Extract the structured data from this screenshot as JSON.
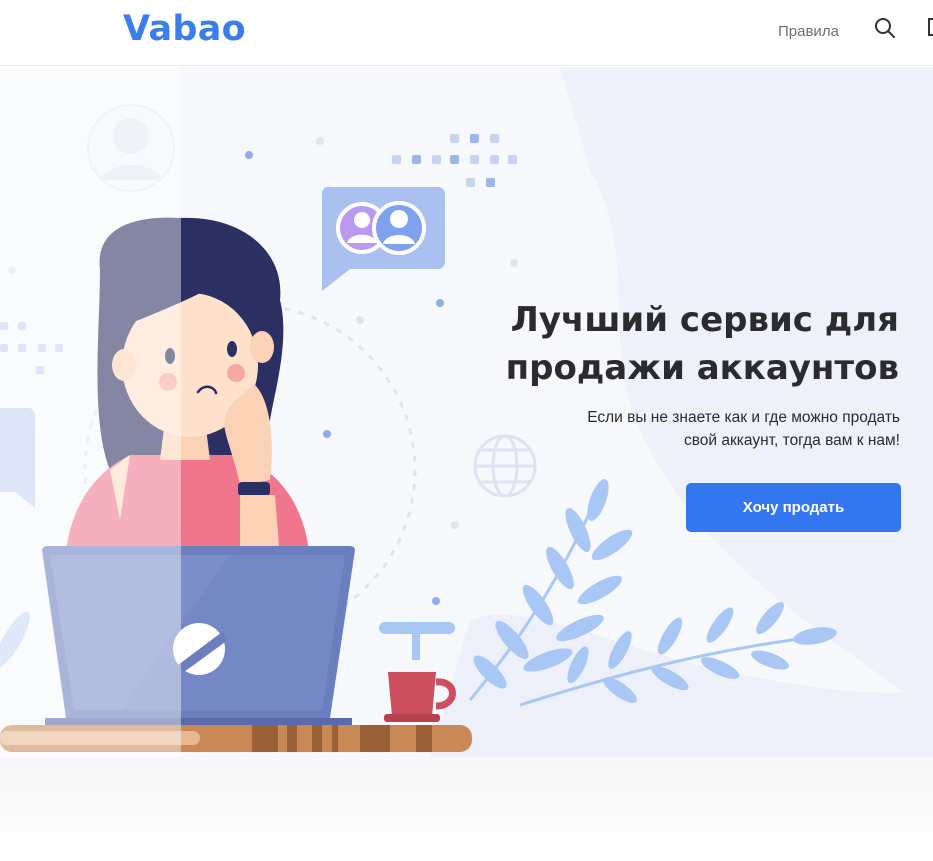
{
  "header": {
    "logo": "Vabao",
    "nav_rules": "Правила",
    "search_icon": "search-icon",
    "menu_icon": "menu-icon"
  },
  "hero": {
    "title_line1": "Лучший сервис для",
    "title_line2": "продажи аккаунтов",
    "subtitle_line1": "Если вы не знаете как и где можно продать",
    "subtitle_line2": "свой аккаунт, тогда вам к нам!",
    "cta_label": "Хочу продать"
  },
  "colors": {
    "brand": "#3b7de9",
    "cta": "#3377f0",
    "title": "#2b2b2f",
    "hero_bg": "#f7f8fc"
  }
}
